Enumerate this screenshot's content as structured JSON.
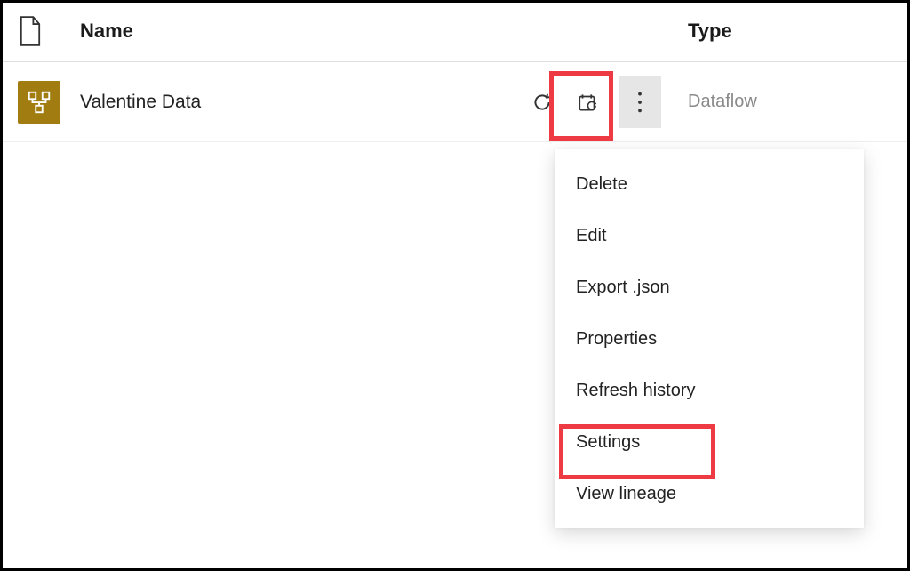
{
  "columns": {
    "name": "Name",
    "type": "Type"
  },
  "row": {
    "name": "Valentine Data",
    "type": "Dataflow"
  },
  "menu": {
    "items": [
      "Delete",
      "Edit",
      "Export .json",
      "Properties",
      "Refresh history",
      "Settings",
      "View lineage"
    ]
  }
}
